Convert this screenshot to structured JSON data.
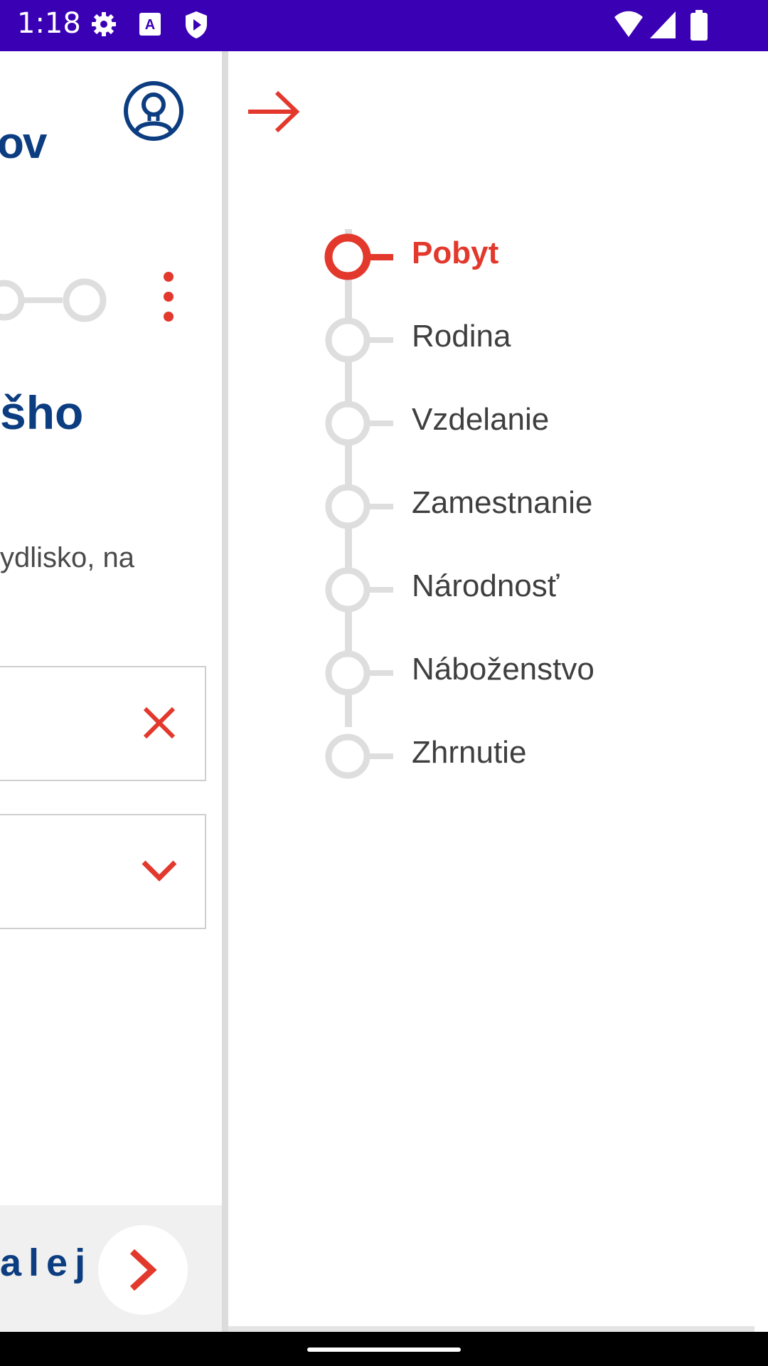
{
  "status_bar": {
    "time": "1:18",
    "icons": [
      "gear-icon",
      "text-a-icon",
      "shield-play-icon",
      "wifi-icon",
      "signal-icon",
      "battery-icon"
    ],
    "color": "#3a00b4"
  },
  "background_page": {
    "brand_fragment": "ov",
    "headline_fragment": "šho",
    "description_fragment": "ydlisko, na",
    "next_label": "alej",
    "brand_color": "#0c3d80",
    "accent_color": "#e3382c"
  },
  "drawer": {
    "close_icon": "arrow-right-icon",
    "steps": [
      {
        "label": "Pobyt",
        "active": true
      },
      {
        "label": "Rodina",
        "active": false
      },
      {
        "label": "Vzdelanie",
        "active": false
      },
      {
        "label": "Zamestnanie",
        "active": false
      },
      {
        "label": "Národnosť",
        "active": false
      },
      {
        "label": "Náboženstvo",
        "active": false
      },
      {
        "label": "Zhrnutie",
        "active": false
      }
    ]
  }
}
